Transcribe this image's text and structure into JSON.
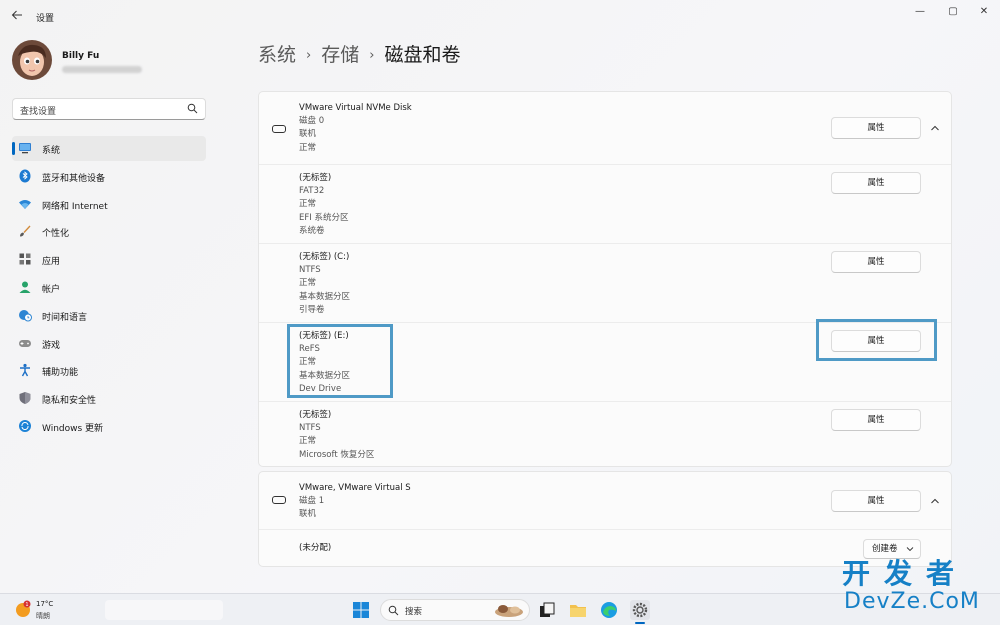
{
  "window": {
    "title": "设置",
    "controls": {
      "minimize": "—",
      "maximize": "▢",
      "close": "✕"
    }
  },
  "user": {
    "name": "Billy Fu"
  },
  "search": {
    "placeholder": "查找设置"
  },
  "sidebar": {
    "items": [
      {
        "label": "系统",
        "icon": "monitor-icon",
        "active": true
      },
      {
        "label": "蓝牙和其他设备",
        "icon": "bluetooth-icon"
      },
      {
        "label": "网络和 Internet",
        "icon": "wifi-icon"
      },
      {
        "label": "个性化",
        "icon": "brush-icon"
      },
      {
        "label": "应用",
        "icon": "apps-icon"
      },
      {
        "label": "帐户",
        "icon": "person-icon"
      },
      {
        "label": "时间和语言",
        "icon": "globe-clock-icon"
      },
      {
        "label": "游戏",
        "icon": "gamepad-icon"
      },
      {
        "label": "辅助功能",
        "icon": "accessibility-icon"
      },
      {
        "label": "隐私和安全性",
        "icon": "shield-icon"
      },
      {
        "label": "Windows 更新",
        "icon": "update-icon"
      }
    ]
  },
  "breadcrumb": {
    "level1": "系统",
    "level2": "存储",
    "current": "磁盘和卷"
  },
  "disk0": {
    "name": "VMware Virtual NVMe Disk",
    "number": "磁盘 0",
    "state": "联机",
    "health": "正常",
    "properties_label": "属性",
    "volumes": [
      {
        "lines": [
          "(无标签)",
          "FAT32",
          "正常",
          "EFI 系统分区",
          "系统卷"
        ],
        "properties_label": "属性"
      },
      {
        "lines": [
          "(无标签) (C:)",
          "NTFS",
          "正常",
          "基本数据分区",
          "引导卷"
        ],
        "properties_label": "属性"
      },
      {
        "lines": [
          "(无标签) (E:)",
          "ReFS",
          "正常",
          "基本数据分区",
          "Dev Drive"
        ],
        "properties_label": "属性"
      },
      {
        "lines": [
          "(无标签)",
          "NTFS",
          "正常",
          "Microsoft 恢复分区"
        ],
        "properties_label": "属性"
      }
    ]
  },
  "disk1": {
    "name": "VMware, VMware Virtual S",
    "number": "磁盘 1",
    "state": "联机",
    "properties_label": "属性",
    "unallocated": "(未分配)",
    "create_volume_label": "创建卷"
  },
  "taskbar": {
    "weather_temp": "17°C",
    "weather_desc": "晴朗",
    "weather_badge": "1",
    "search_placeholder": "搜索"
  },
  "watermark": {
    "top": "开发者",
    "bottom": "DevZe.CoM"
  },
  "colors": {
    "accent": "#0067c0",
    "highlight": "#4f9ac6",
    "watermark": "#1680c6"
  }
}
